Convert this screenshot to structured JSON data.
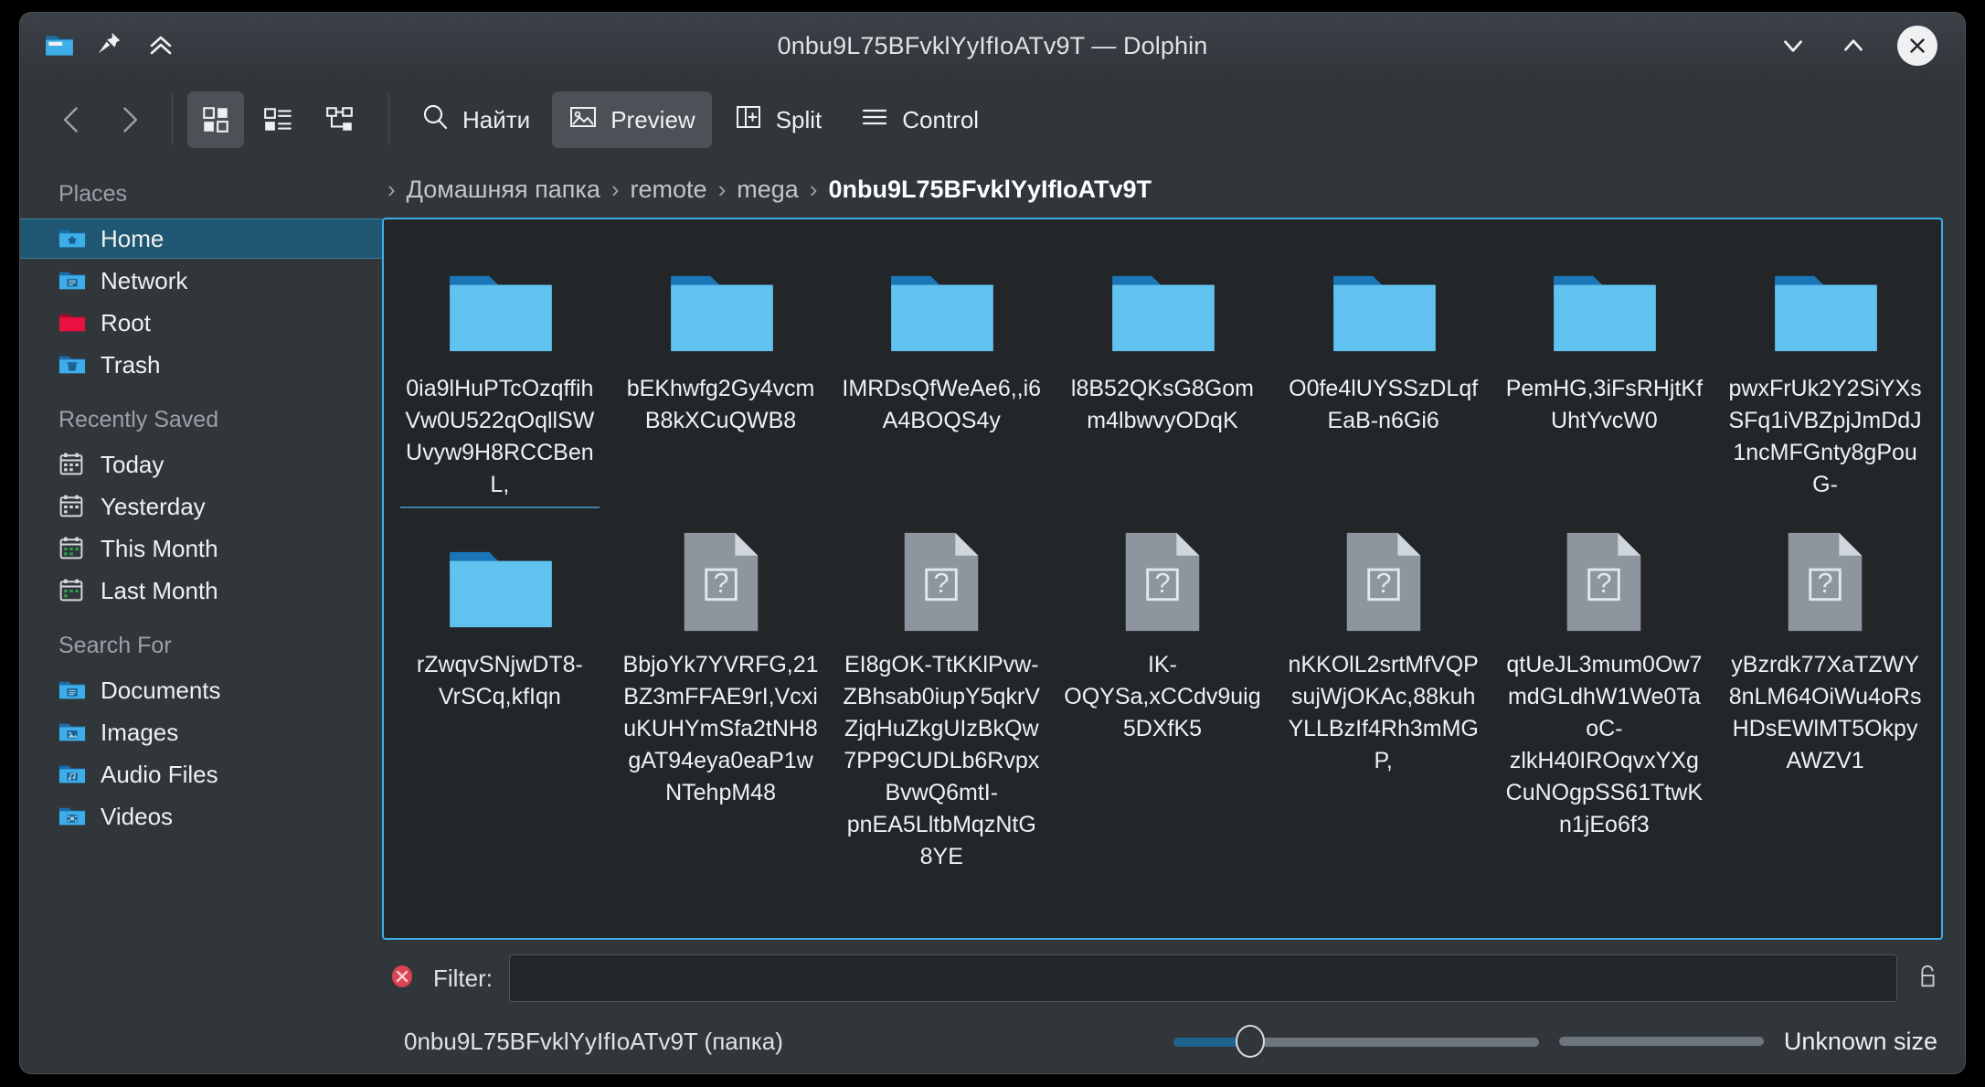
{
  "window": {
    "title": "0nbu9L75BFvklYyIfIoATv9T — Dolphin",
    "app_icon": "folder-icon",
    "pin_icon": "pin-icon",
    "collapse_icon": "double-chevron-up-icon",
    "minimize_icon": "chevron-down-icon",
    "maximize_icon": "chevron-up-icon",
    "close_icon": "close-icon",
    "accent_color": "#3daee9",
    "titlebar_color": "#31363b",
    "view_background": "#232629"
  },
  "toolbar": {
    "back_icon": "chevron-left-icon",
    "forward_icon": "chevron-right-icon",
    "view_icons_label": "icons-view-icon",
    "view_details_label": "details-view-icon",
    "view_tree_label": "tree-view-icon",
    "find_label": "Найти",
    "find_icon": "search-icon",
    "preview_label": "Preview",
    "preview_icon": "image-preview-icon",
    "split_label": "Split",
    "split_icon": "split-view-icon",
    "control_label": "Control",
    "control_icon": "hamburger-menu-icon",
    "active_view": "icons",
    "preview_active": true
  },
  "sidebar": {
    "sections": [
      {
        "title": "Places",
        "items": [
          {
            "label": "Home",
            "icon": "home-folder-icon",
            "selected": true
          },
          {
            "label": "Network",
            "icon": "network-folder-icon",
            "selected": false
          },
          {
            "label": "Root",
            "icon": "root-folder-icon",
            "selected": false
          },
          {
            "label": "Trash",
            "icon": "trash-folder-icon",
            "selected": false
          }
        ]
      },
      {
        "title": "Recently Saved",
        "items": [
          {
            "label": "Today",
            "icon": "calendar-icon",
            "selected": false
          },
          {
            "label": "Yesterday",
            "icon": "calendar-icon",
            "selected": false
          },
          {
            "label": "This Month",
            "icon": "calendar-icon",
            "selected": false
          },
          {
            "label": "Last Month",
            "icon": "calendar-icon",
            "selected": false
          }
        ]
      },
      {
        "title": "Search For",
        "items": [
          {
            "label": "Documents",
            "icon": "documents-folder-icon",
            "selected": false
          },
          {
            "label": "Images",
            "icon": "images-folder-icon",
            "selected": false
          },
          {
            "label": "Audio Files",
            "icon": "audio-folder-icon",
            "selected": false
          },
          {
            "label": "Videos",
            "icon": "videos-folder-icon",
            "selected": false
          }
        ]
      }
    ]
  },
  "breadcrumb": {
    "separator": "›",
    "crumbs": [
      {
        "label": "Домашняя папка",
        "current": false
      },
      {
        "label": "remote",
        "current": false
      },
      {
        "label": "mega",
        "current": false
      },
      {
        "label": "0nbu9L75BFvklYyIfIoATv9T",
        "current": true
      }
    ]
  },
  "files": {
    "rows": [
      [
        {
          "name": "0ia9lHuPTcOzqffihVw0U522qOqllSWUvyw9H8RCCBenL,",
          "type": "folder",
          "rule": true
        },
        {
          "name": "bEKhwfg2Gy4vcmB8kXCuQWB8",
          "type": "folder",
          "rule": false
        },
        {
          "name": "IMRDsQfWeAe6,,i6A4BOQS4y",
          "type": "folder",
          "rule": false
        },
        {
          "name": "l8B52QKsG8Gomm4lbwvyODqK",
          "type": "folder",
          "rule": false
        },
        {
          "name": "O0fe4lUYSSzDLqfEaB-n6Gi6",
          "type": "folder",
          "rule": false
        },
        {
          "name": "PemHG,3iFsRHjtKfUhtYvcW0",
          "type": "folder",
          "rule": false
        },
        {
          "name": "pwxFrUk2Y2SiYXsSFq1iVBZpjJmDdJ1ncMFGnty8gPouG-",
          "type": "folder",
          "rule": false
        }
      ],
      [
        {
          "name": "rZwqvSNjwDT8-VrSCq,kfIqn",
          "type": "folder",
          "rule": false
        },
        {
          "name": "BbjoYk7YVRFG,21BZ3mFFAE9rI,VcxiuKUHYmSfa2tNH8gAT94eya0eaP1wNTehpM48",
          "type": "unknown",
          "rule": false
        },
        {
          "name": "EI8gOK-TtKKlPvw-ZBhsab0iupY5qkrVZjqHuZkgUIzBkQw7PP9CUDLb6RvpxBvwQ6mtI-pnEA5LltbMqzNtG8YE",
          "type": "unknown",
          "rule": false
        },
        {
          "name": "IK-OQYSa,xCCdv9uig5DXfK5",
          "type": "unknown",
          "rule": false
        },
        {
          "name": "nKKOlL2srtMfVQPsujWjOKAc,88kuhYLLBzIf4Rh3mMGP,",
          "type": "unknown",
          "rule": false
        },
        {
          "name": "qtUeJL3mum0Ow7mdGLdhW1We0TaoC-zlkH40IROqvxYXgCuNOgpSS61TtwKn1jEo6f3",
          "type": "unknown",
          "rule": false
        },
        {
          "name": "yBzrdk77XaTZWY8nLM64OiWu4oRsHDsEWlMT5OkpyAWZV1",
          "type": "unknown",
          "rule": false
        }
      ]
    ]
  },
  "filter": {
    "close_icon": "filter-close-icon",
    "label": "Filter:",
    "value": "",
    "placeholder": "",
    "lock_icon": "lock-icon"
  },
  "status": {
    "text": "0nbu9L75BFvklYyIfIoATv9T (папка)",
    "zoom_icon": "zoom-slider",
    "size_text": "Unknown size"
  }
}
